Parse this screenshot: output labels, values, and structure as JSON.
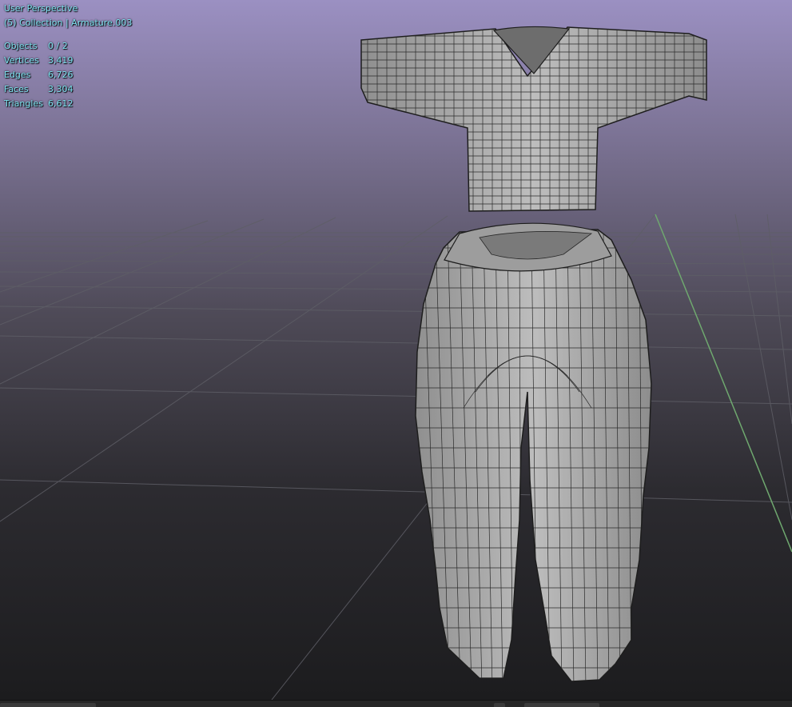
{
  "viewport": {
    "view_name": "User Perspective",
    "collection_info": "(5) Collection | Armature.003",
    "stats": [
      {
        "label": "Objects",
        "value": "0 / 2"
      },
      {
        "label": "Vertices",
        "value": "3,419"
      },
      {
        "label": "Edges",
        "value": "6,726"
      },
      {
        "label": "Faces",
        "value": "3,304"
      },
      {
        "label": "Triangles",
        "value": "6,612"
      }
    ],
    "overlay_color": "#7fe3f2",
    "y_axis_color": "#6fa86f"
  }
}
